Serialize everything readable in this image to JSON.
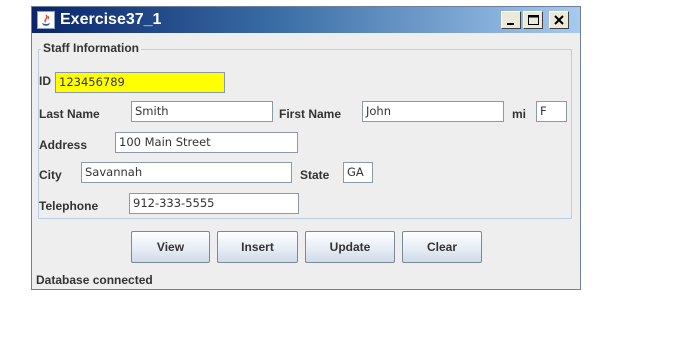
{
  "window": {
    "title": "Exercise37_1",
    "controls": {
      "minimize_icon": "minimize-icon",
      "maximize_icon": "maximize-icon",
      "close_icon": "close-icon"
    }
  },
  "group": {
    "title": "Staff Information"
  },
  "form": {
    "id": {
      "label": "ID",
      "value": "123456789"
    },
    "last_name": {
      "label": "Last Name",
      "value": "Smith"
    },
    "first_name": {
      "label": "First Name",
      "value": "John"
    },
    "mi": {
      "label": "mi",
      "value": "F"
    },
    "address": {
      "label": "Address",
      "value": "100 Main Street"
    },
    "city": {
      "label": "City",
      "value": "Savannah"
    },
    "state": {
      "label": "State",
      "value": "GA"
    },
    "telephone": {
      "label": "Telephone",
      "value": "912-333-5555"
    }
  },
  "buttons": {
    "view": "View",
    "insert": "Insert",
    "update": "Update",
    "clear": "Clear"
  },
  "status": "Database connected",
  "colors": {
    "id_field_highlight": "#ffff00",
    "titlebar_start": "#0a246a",
    "titlebar_end": "#a6caf0"
  }
}
